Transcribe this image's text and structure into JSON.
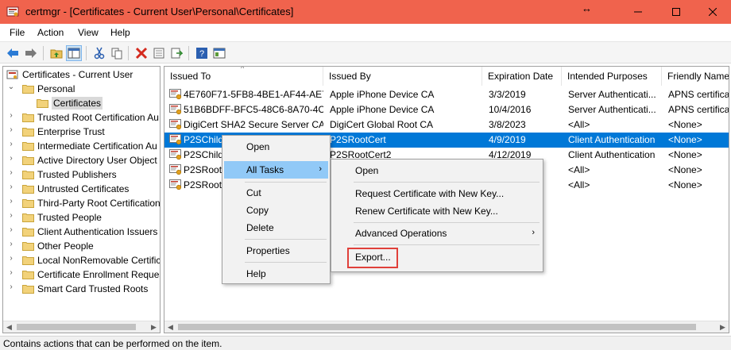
{
  "window": {
    "title": "certmgr - [Certificates - Current User\\Personal\\Certificates]",
    "resize_hint": "↔",
    "colors": {
      "titlebar": "#f0634d",
      "selection": "#0078d7",
      "menu_highlight": "#91c9f7",
      "annotation": "#e0403a"
    }
  },
  "menubar": {
    "items": [
      "File",
      "Action",
      "View",
      "Help"
    ]
  },
  "toolbar": {
    "icons": [
      "back-arrow-icon",
      "forward-arrow-icon",
      "up-folder-icon",
      "show-hide-tree-icon",
      "cut-icon",
      "copy-icon",
      "delete-icon",
      "properties-icon",
      "export-list-icon",
      "help-icon",
      "view-icon"
    ]
  },
  "tree": {
    "root": "Certificates - Current User",
    "items": [
      {
        "label": "Personal",
        "expanded": true
      },
      {
        "label": "Certificates",
        "selected": true
      },
      {
        "label": "Trusted Root Certification Au"
      },
      {
        "label": "Enterprise Trust"
      },
      {
        "label": "Intermediate Certification Au"
      },
      {
        "label": "Active Directory User Object"
      },
      {
        "label": "Trusted Publishers"
      },
      {
        "label": "Untrusted Certificates"
      },
      {
        "label": "Third-Party Root Certification"
      },
      {
        "label": "Trusted People"
      },
      {
        "label": "Client Authentication Issuers"
      },
      {
        "label": "Other People"
      },
      {
        "label": "Local NonRemovable Certific"
      },
      {
        "label": "Certificate Enrollment Reques"
      },
      {
        "label": "Smart Card Trusted Roots"
      }
    ]
  },
  "table": {
    "columns": [
      "Issued To",
      "Issued By",
      "Expiration Date",
      "Intended Purposes",
      "Friendly Name"
    ],
    "rows": [
      [
        "4E760F71-5FB8-4BE1-AF44-AE7...",
        "Apple iPhone Device CA",
        "3/3/2019",
        "Server Authenticati...",
        "APNS certificat"
      ],
      [
        "51B6BDFF-BFC5-48C6-8A70-4C...",
        "Apple iPhone Device CA",
        "10/4/2016",
        "Server Authenticati...",
        "APNS certificat"
      ],
      [
        "DigiCert SHA2 Secure Server CA",
        "DigiCert Global Root CA",
        "3/8/2023",
        "<All>",
        "<None>"
      ],
      [
        "P2SChildC",
        "P2SRootCert",
        "4/9/2019",
        "Client Authentication",
        "<None>"
      ],
      [
        "P2SChild",
        "P2SRootCert2",
        "4/12/2019",
        "Client Authentication",
        "<None>"
      ],
      [
        "P2SRoot",
        "",
        "",
        "<All>",
        "<None>"
      ],
      [
        "P2SRoot",
        "",
        "",
        "<All>",
        "<None>"
      ]
    ],
    "selected_row": 3
  },
  "context_menu": {
    "items": [
      "Open",
      "All Tasks",
      "Cut",
      "Copy",
      "Delete",
      "Properties",
      "Help"
    ],
    "highlighted": "All Tasks"
  },
  "submenu": {
    "items": [
      "Open",
      "Request Certificate with New Key...",
      "Renew Certificate with New Key...",
      "Advanced Operations",
      "Export..."
    ],
    "has_submenu_arrow": [
      "Advanced Operations"
    ]
  },
  "statusbar": {
    "text": "Contains actions that can be performed on the item."
  }
}
